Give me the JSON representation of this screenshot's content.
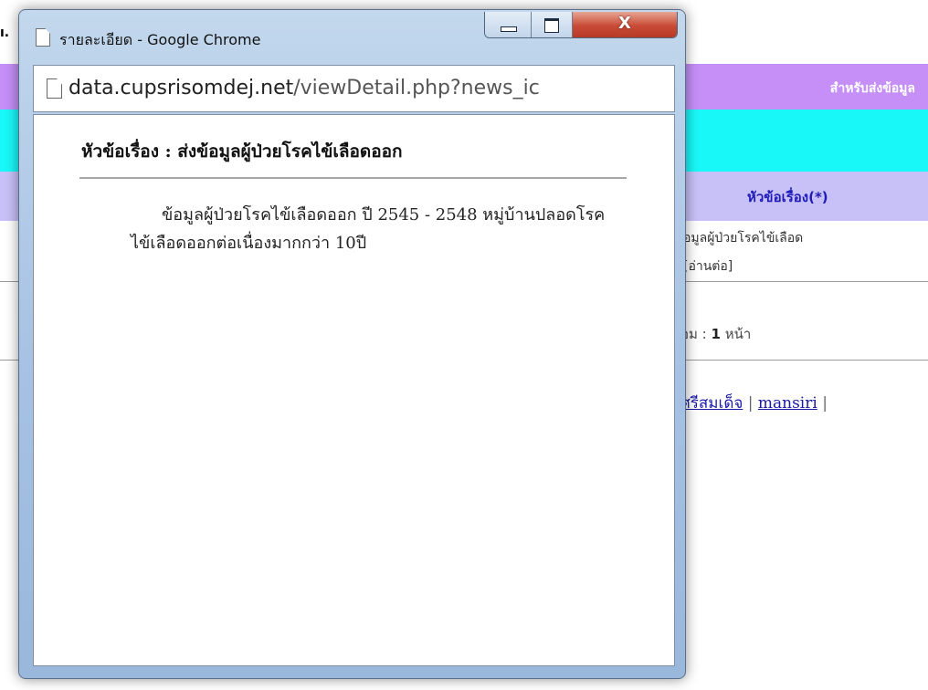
{
  "background_page": {
    "left_fragment": "ı.",
    "purple_bar_text": "สำหรับส่งข้อมูล",
    "table_header": "หัวข้อเรื่อง(*)",
    "row_line1": "อมูลผู้ป่วยโรคไข้เลือด",
    "row_line2": "[อ่านต่อ]",
    "pages_prefix": "อม :",
    "pages_count": "1",
    "pages_suffix": "หน้า",
    "link_1": "ศรีสมเด็จ",
    "link_sep": "|",
    "link_2": "mansiri",
    "colors": {
      "purple": "#c58ff7",
      "cyan": "#19f8f8",
      "lavender": "#c7c1f8",
      "link": "#1a1aa8"
    }
  },
  "popup": {
    "window_title": "รายละเอียด - Google Chrome",
    "controls": {
      "minimize_icon": "minimize-icon",
      "maximize_icon": "maximize-icon",
      "close_label": "X"
    },
    "url_domain": "data.cupsrisomdej.net",
    "url_path": "/viewDetail.php?news_ic",
    "heading": "หัวข้อเรื่อง : ส่งข้อมูลผู้ป่วยโรคไข้เลือดออก",
    "body_text": "ข้อมูลผู้ป่วยโรคไข้เลือดออก ปี 2545 - 2548 หมู่บ้านปลอดโรคไข้เลือดออกต่อเนื่องมากกว่า 10ปี"
  }
}
